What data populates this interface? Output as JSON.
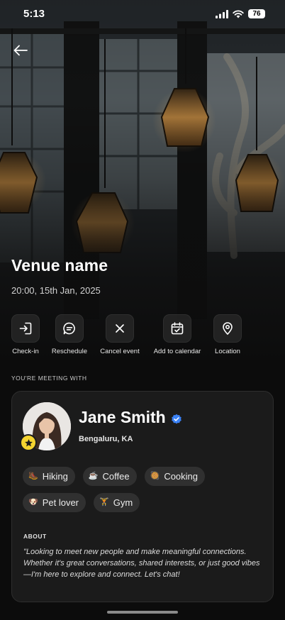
{
  "status_bar": {
    "time": "5:13",
    "battery": "76"
  },
  "venue": {
    "name": "Venue name",
    "datetime": "20:00, 15th Jan, 2025"
  },
  "actions": [
    {
      "label": "Check-in",
      "icon": "check-in-icon"
    },
    {
      "label": "Reschedule",
      "icon": "chat-bubble-icon"
    },
    {
      "label": "Cancel event",
      "icon": "close-icon"
    },
    {
      "label": "Add to calendar",
      "icon": "calendar-check-icon"
    },
    {
      "label": "Location",
      "icon": "map-pin-icon"
    }
  ],
  "meeting": {
    "heading": "YOU'RE MEETING WITH",
    "person": {
      "name": "Jane Smith",
      "location": "Bengaluru, KA",
      "verified": true,
      "badge_icon": "star-icon"
    },
    "interests": [
      {
        "emoji": "🥾",
        "label": "Hiking"
      },
      {
        "emoji": "☕",
        "label": "Coffee"
      },
      {
        "emoji": "🥘",
        "label": "Cooking"
      },
      {
        "emoji": "🐶",
        "label": "Pet lover"
      },
      {
        "emoji": "🏋",
        "label": "Gym"
      }
    ],
    "about": {
      "heading": "ABOUT",
      "text": "\"Looking to meet new people and make meaningful connections. Whether it's great conversations, shared interests, or just good vibes—I'm here to explore and connect. Let's chat!"
    }
  },
  "colors": {
    "background": "#0c0c0c",
    "card": "#1b1b1b",
    "tag": "#303030",
    "badge": "#f5d430",
    "verified": "#3b82f6"
  }
}
